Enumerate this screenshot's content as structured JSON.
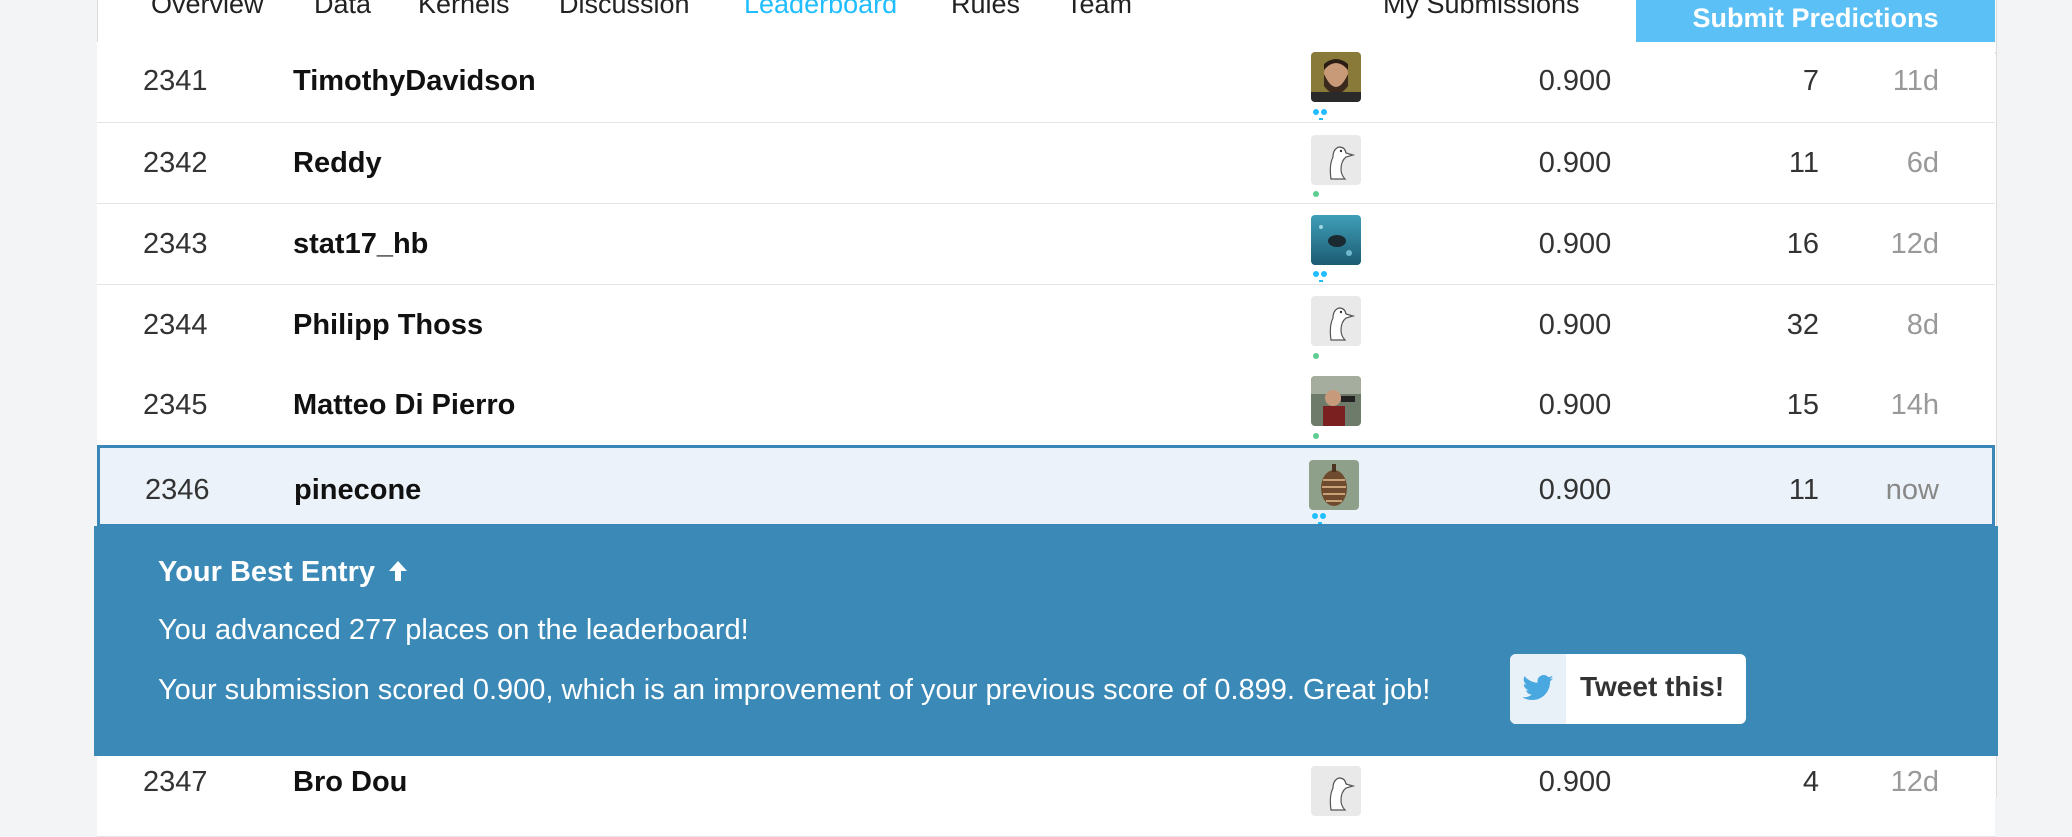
{
  "tabs": [
    {
      "label": "Overview"
    },
    {
      "label": "Data"
    },
    {
      "label": "Kernels"
    },
    {
      "label": "Discussion"
    },
    {
      "label": "Leaderboard",
      "active": true
    },
    {
      "label": "Rules"
    },
    {
      "label": "Team"
    }
  ],
  "header": {
    "my_submissions": "My Submissions",
    "submit_label": "Submit Predictions"
  },
  "rows": [
    {
      "rank": "2341",
      "name": "TimothyDavidson",
      "avatar": "photo-bearded-man",
      "tier": "blue",
      "score": "0.900",
      "entries": "7",
      "last": "11d"
    },
    {
      "rank": "2342",
      "name": "Reddy",
      "avatar": "default-goose",
      "tier": "green",
      "score": "0.900",
      "entries": "11",
      "last": "6d"
    },
    {
      "rank": "2343",
      "name": "stat17_hb",
      "avatar": "photo-underwater",
      "tier": "blue",
      "score": "0.900",
      "entries": "16",
      "last": "12d"
    },
    {
      "rank": "2344",
      "name": "Philipp Thoss",
      "avatar": "default-goose",
      "tier": "green",
      "score": "0.900",
      "entries": "32",
      "last": "8d"
    },
    {
      "rank": "2345",
      "name": "Matteo Di Pierro",
      "avatar": "photo-person-outdoors",
      "tier": "green",
      "score": "0.900",
      "entries": "15",
      "last": "14h"
    },
    {
      "rank": "2346",
      "name": "pinecone",
      "avatar": "photo-pinecone",
      "tier": "blue",
      "score": "0.900",
      "entries": "11",
      "last": "now",
      "is_me": true
    },
    {
      "rank": "2347",
      "name": "Bro Dou",
      "avatar": "default-goose",
      "tier": "green",
      "score": "0.900",
      "entries": "4",
      "last": "12d"
    }
  ],
  "banner": {
    "title": "Your Best Entry",
    "title_icon": "arrow-up-icon",
    "advanced": "You advanced 277 places on the leaderboard!",
    "scored": "Your submission scored 0.900, which is an improvement of your previous score of 0.899. Great job!",
    "tweet_label": "Tweet this!",
    "tweet_icon": "twitter-bird-icon"
  },
  "colors": {
    "accent": "#20beff",
    "banner_bg": "#3a89b6",
    "highlight_row": "#ebf2f9",
    "highlight_border": "#3a87b7"
  }
}
